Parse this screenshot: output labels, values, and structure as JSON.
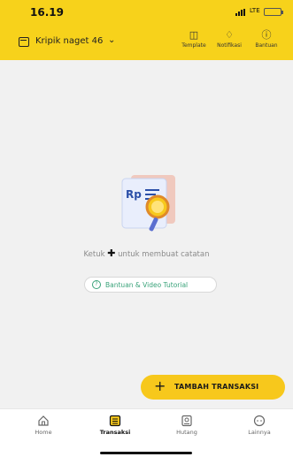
{
  "status_bar": {
    "time": "16.19",
    "network": "LTE"
  },
  "toolbar": {
    "store_name": "Kripik naget 46",
    "store_icon": "store-icon",
    "chevron_icon": "chevron-down-icon",
    "actions": [
      {
        "label": "Template",
        "icon": "template-icon"
      },
      {
        "label": "Notifikasi",
        "icon": "bell-icon"
      },
      {
        "label": "Bantuan",
        "icon": "help-icon"
      }
    ]
  },
  "empty_state": {
    "illustration_text": "Rp",
    "hint_prefix": "Ketuk",
    "hint_suffix": "untuk membuat catatan",
    "tutorial_label": "Bantuan & Video Tutorial"
  },
  "fab": {
    "label": "TAMBAH TRANSAKSI"
  },
  "bottom_nav": {
    "items": [
      {
        "label": "Home",
        "icon": "home-icon"
      },
      {
        "label": "Transaksi",
        "icon": "transaction-icon"
      },
      {
        "label": "Hutang",
        "icon": "debt-icon"
      },
      {
        "label": "Lainnya",
        "icon": "more-icon"
      }
    ],
    "active": "Transaksi"
  },
  "colors": {
    "accent": "#f7d21b",
    "fab": "#f7c81c",
    "link": "#3aa37a"
  }
}
